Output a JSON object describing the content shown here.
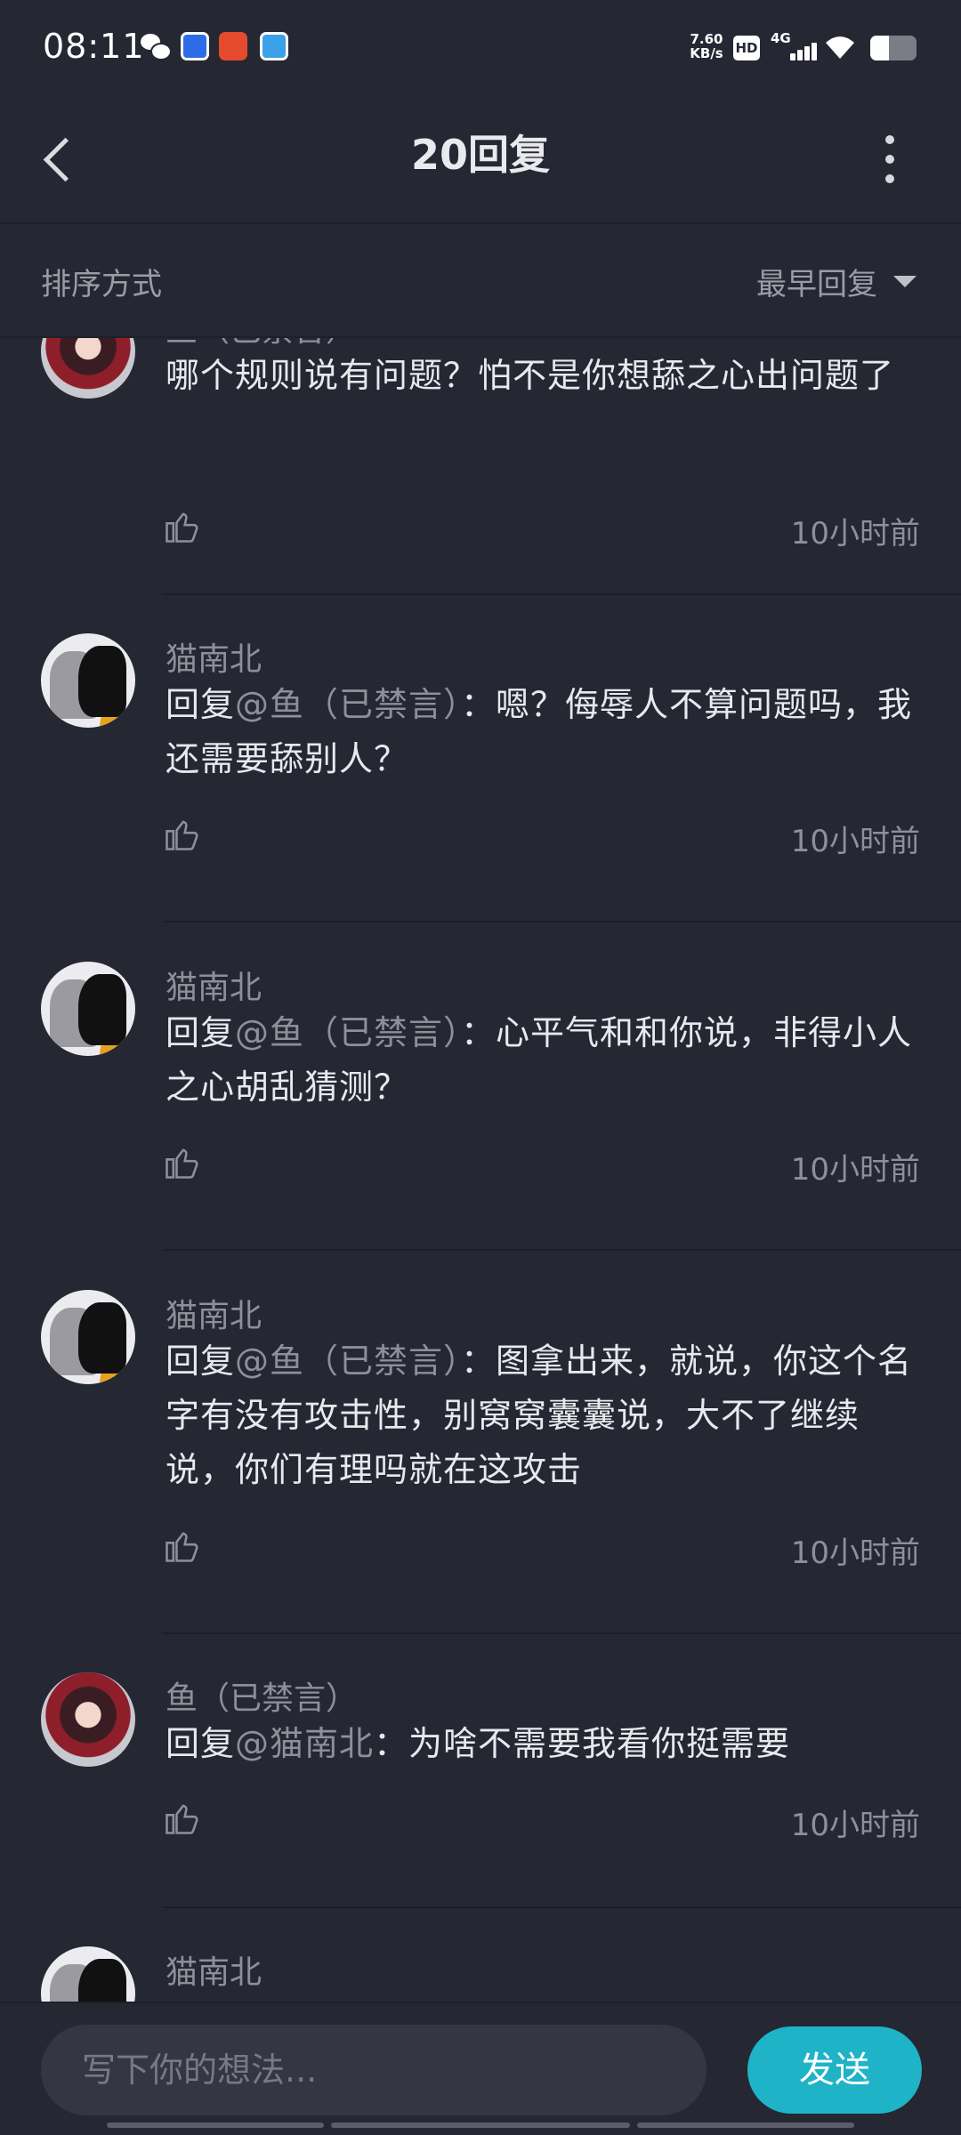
{
  "status_bar": {
    "time": "08:11",
    "net_speed_value": "7.60",
    "net_speed_unit": "KB/s",
    "hd_label": "HD",
    "network_label": "4G",
    "battery_level": 0.4
  },
  "header": {
    "title": "20回复"
  },
  "sort": {
    "label": "排序方式",
    "selected": "最早回复"
  },
  "comments": [
    {
      "author": "鱼（已禁言）",
      "reply_prefix": "",
      "mention": "",
      "text": "哪个规则说有问题？怕不是你想舔之心出问题了",
      "time": "10小时前",
      "avatar": "fox"
    },
    {
      "author": "猫南北",
      "reply_prefix": "回复",
      "mention": "@鱼（已禁言）",
      "text": "：嗯？侮辱人不算问题吗，我还需要舔别人？",
      "time": "10小时前",
      "avatar": "cat"
    },
    {
      "author": "猫南北",
      "reply_prefix": "回复",
      "mention": "@鱼（已禁言）",
      "text": "：心平气和和你说，非得小人之心胡乱猜测？",
      "time": "10小时前",
      "avatar": "cat"
    },
    {
      "author": "猫南北",
      "reply_prefix": "回复",
      "mention": "@鱼（已禁言）",
      "text": "：图拿出来，就说，你这个名字有没有攻击性，别窝窝囊囊说，大不了继续说，你们有理吗就在这攻击",
      "time": "10小时前",
      "avatar": "cat"
    },
    {
      "author": "鱼（已禁言）",
      "reply_prefix": "回复",
      "mention": "@猫南北",
      "text": "：为啥不需要我看你挺需要",
      "time": "10小时前",
      "avatar": "fox"
    },
    {
      "author": "猫南北",
      "reply_prefix": "",
      "mention": "",
      "text": "",
      "time": "",
      "avatar": "cat"
    }
  ],
  "input": {
    "placeholder": "写下你的想法...",
    "value": ""
  },
  "send_label": "发送",
  "icons": {
    "back": "back-arrow-icon",
    "more": "more-vertical-icon",
    "sort": "caret-down-icon",
    "like": "thumbs-up-icon"
  },
  "colors": {
    "background": "#252733",
    "accent": "#1fb3c7",
    "muted_text": "#8e8f99"
  }
}
